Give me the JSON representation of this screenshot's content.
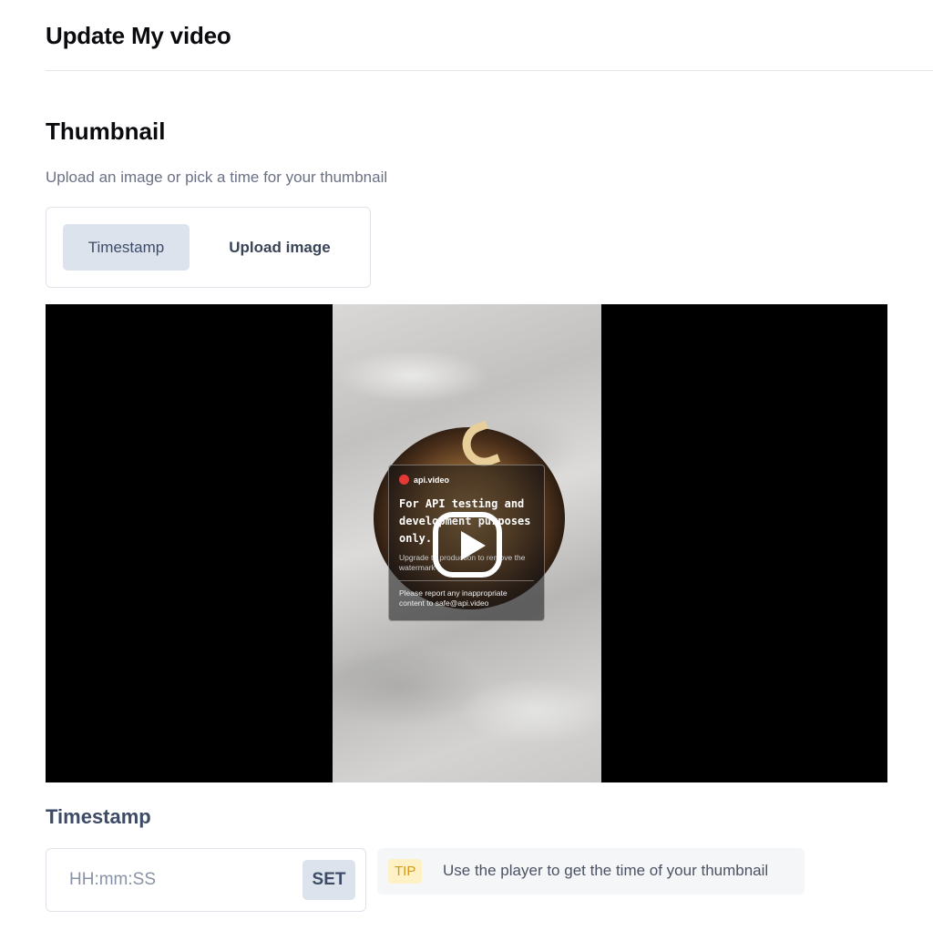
{
  "page": {
    "title": "Update My video"
  },
  "thumbnail": {
    "title": "Thumbnail",
    "description": "Upload an image or pick a time for your thumbnail",
    "tabs": [
      {
        "label": "Timestamp",
        "active": true
      },
      {
        "label": "Upload image",
        "active": false
      }
    ]
  },
  "player": {
    "watermark": {
      "brand": "api.video",
      "headline": "For API testing and development purposes only.",
      "subtext": "Upgrade to production to remove the watermark",
      "report": "Please report any inappropriate content to safe@api.video"
    },
    "play_icon": "play-icon"
  },
  "timestamp": {
    "label": "Timestamp",
    "input_value": "",
    "input_placeholder": "HH:mm:SS",
    "set_label": "SET"
  },
  "tip": {
    "badge": "TIP",
    "text": "Use the player to get the time of your thumbnail"
  },
  "colors": {
    "accent_bg": "#dce3ed",
    "accent_text": "#3d4b66",
    "tip_badge_bg": "#fdf1c5",
    "tip_badge_text": "#d49a1a"
  }
}
